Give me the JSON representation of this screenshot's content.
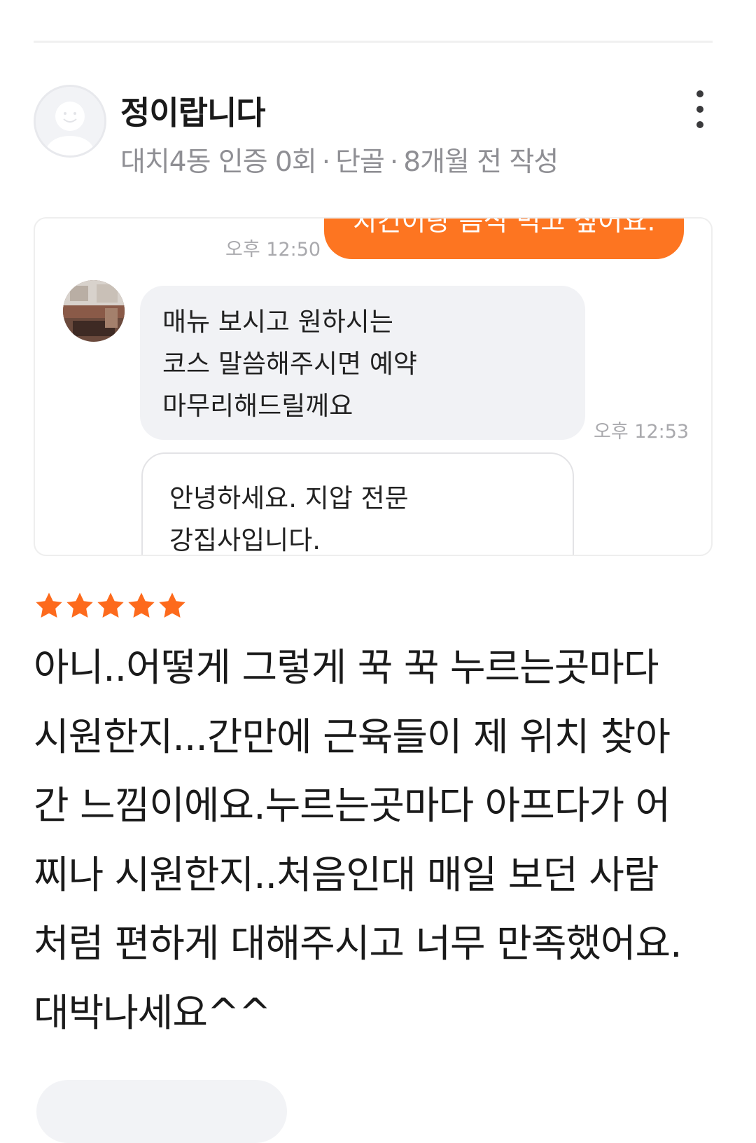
{
  "review": {
    "author": {
      "name": "정이랍니다",
      "location": "대치4동 인증 0회",
      "status": "단골",
      "posted": "8개월 전 작성"
    },
    "meta_separator": "·",
    "photo": {
      "outgoing_message": "치킨이랑 음식 먹고 싶어요.",
      "outgoing_time": "오후 12:50",
      "incoming_lines": [
        "매뉴 보시고 원하시는",
        "코스 말씀해주시면 예약",
        "마무리해드릴께요"
      ],
      "incoming_time": "오후 12:53",
      "card_lines": [
        "안녕하세요. 지압 전문",
        "강집사입니다."
      ]
    },
    "rating": 5,
    "rating_max": 5,
    "text_lines": [
      "아니..어떻게 그렇게 꾹 꾹 누르는곳마다",
      "시원한지...간만에 근육들이 제 위치 찾아",
      "간 느낌이에요.누르는곳마다 아프다가 어",
      "찌나 시원한지..처음인대 매일 보던 사람",
      "처럼 편하게 대해주시고 너무 만족했어요.",
      "대박나세요^^"
    ]
  },
  "icons": {
    "avatar": "default-profile-icon",
    "more": "more-vertical-icon",
    "star": "star-icon"
  },
  "colors": {
    "accent": "#fd7521",
    "star": "#fd6a1c",
    "meta_text": "#8f8f94"
  }
}
